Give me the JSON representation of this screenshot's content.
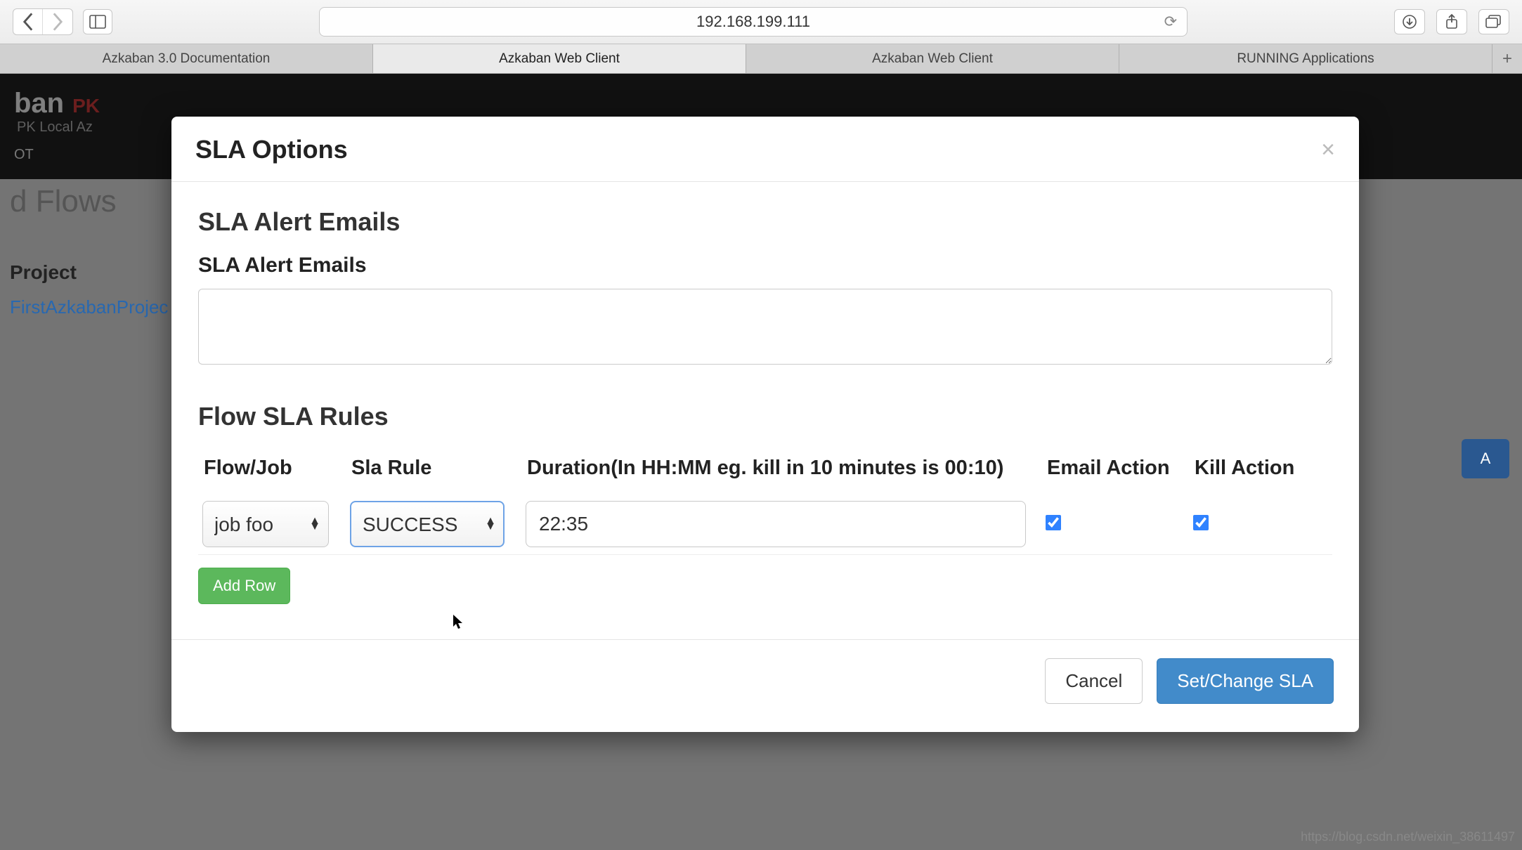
{
  "browser": {
    "url": "192.168.199.111",
    "tabs": [
      "Azkaban 3.0 Documentation",
      "Azkaban Web Client",
      "Azkaban Web Client",
      "RUNNING Applications"
    ],
    "active_tab_index": 1
  },
  "azkaban": {
    "brand": "ban",
    "badge": "PK",
    "subtitle": "PK Local Az",
    "nav": "OT",
    "page_title": "d Flows",
    "sidebar_project_h": "Project",
    "sidebar_link": "FirstAzkabanProjec",
    "bg_btn": "A"
  },
  "modal": {
    "title": "SLA Options",
    "emails_section": "SLA Alert Emails",
    "emails_label": "SLA Alert Emails",
    "rules_section": "Flow SLA Rules",
    "headers": {
      "flow": "Flow/Job",
      "rule": "Sla Rule",
      "duration": "Duration(In HH:MM eg. kill in 10 minutes is 00:10)",
      "email": "Email Action",
      "kill": "Kill Action"
    },
    "row": {
      "flow": "job foo",
      "rule": "SUCCESS",
      "duration": "22:35",
      "email_checked": true,
      "kill_checked": true
    },
    "add_row": "Add Row",
    "cancel": "Cancel",
    "submit": "Set/Change SLA"
  },
  "watermark": "https://blog.csdn.net/weixin_38611497"
}
